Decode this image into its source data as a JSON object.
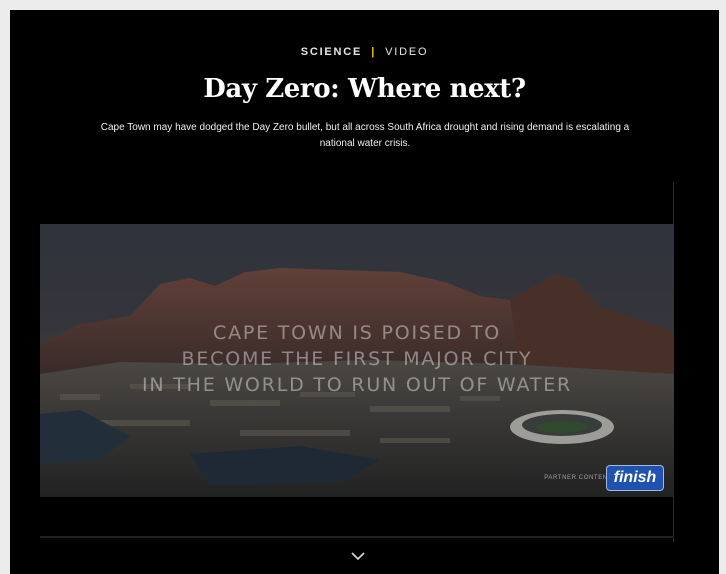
{
  "header": {
    "category": "SCIENCE",
    "separator": "|",
    "type": "VIDEO"
  },
  "article": {
    "title": "Day Zero: Where next?",
    "dek": "Cape Town may have dodged the Day Zero bullet, but all across South Africa drought and rising demand is escalating a national water crisis."
  },
  "video": {
    "overlay_lines": [
      "CAPE TOWN IS POISED TO",
      "BECOME THE FIRST MAJOR CITY",
      "IN THE WORLD TO RUN OUT OF WATER"
    ],
    "partner_label": "PARTNER CONTENT",
    "brand_logo_text": "finish"
  },
  "controls": {
    "scroll_icon": "chevron-down-icon"
  },
  "colors": {
    "background": "#000000",
    "accent": "#f2c200",
    "text": "#ffffff"
  }
}
